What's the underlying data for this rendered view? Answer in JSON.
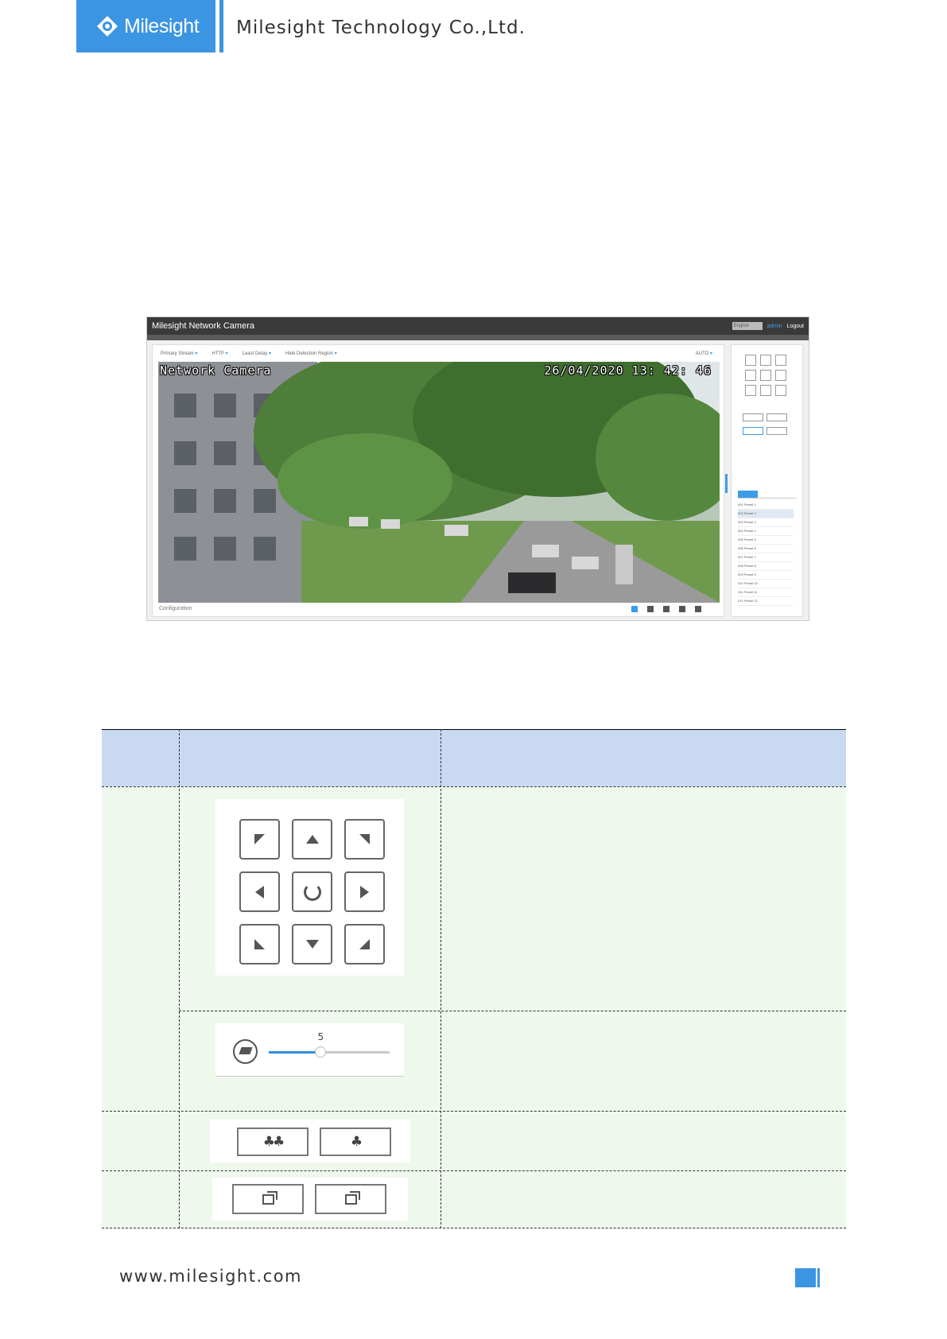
{
  "header": {
    "logo_text": "Milesight",
    "company": "Milesight Technology Co.,Ltd."
  },
  "screenshot": {
    "app_title": "Milesight Network Camera",
    "language": "English",
    "user": "admin",
    "logout": "Logout",
    "toolbar": [
      "Primary Stream",
      "HTTP",
      "Least Delay",
      "Hide Detection Region"
    ],
    "zoom_mode": "AUTO",
    "osd_left": "Network Camera",
    "osd_right": "26/04/2020 13: 42: 46",
    "configuration": "Configuration",
    "presets": [
      "001 Preset 1",
      "002 Preset 2",
      "003 Preset 3",
      "004 Preset 4",
      "005 Preset 5",
      "006 Preset 6",
      "007 Preset 7",
      "008 Preset 8",
      "009 Preset 9",
      "010 Preset 10",
      "011 Preset 11",
      "012 Preset 12"
    ],
    "selected_preset": 1
  },
  "table": {
    "speed_value": "5",
    "speed_fraction": 0.43
  },
  "footer": {
    "url": "www.milesight.com"
  },
  "colors": {
    "brand": "#3b95e3",
    "table_header": "#c9d9f2",
    "table_body": "#eef8ec"
  }
}
